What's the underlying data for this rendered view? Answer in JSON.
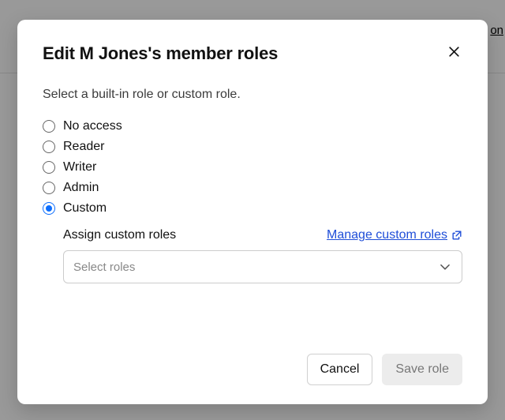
{
  "background": {
    "link_fragment": "on"
  },
  "modal": {
    "title": "Edit M Jones's member roles",
    "subtitle": "Select a built-in role or custom role.",
    "roles": [
      {
        "label": "No access",
        "selected": false
      },
      {
        "label": "Reader",
        "selected": false
      },
      {
        "label": "Writer",
        "selected": false
      },
      {
        "label": "Admin",
        "selected": false
      },
      {
        "label": "Custom",
        "selected": true
      }
    ],
    "custom": {
      "assign_label": "Assign custom roles",
      "manage_link": "Manage custom roles",
      "select_placeholder": "Select roles"
    },
    "footer": {
      "cancel": "Cancel",
      "save": "Save role"
    }
  }
}
